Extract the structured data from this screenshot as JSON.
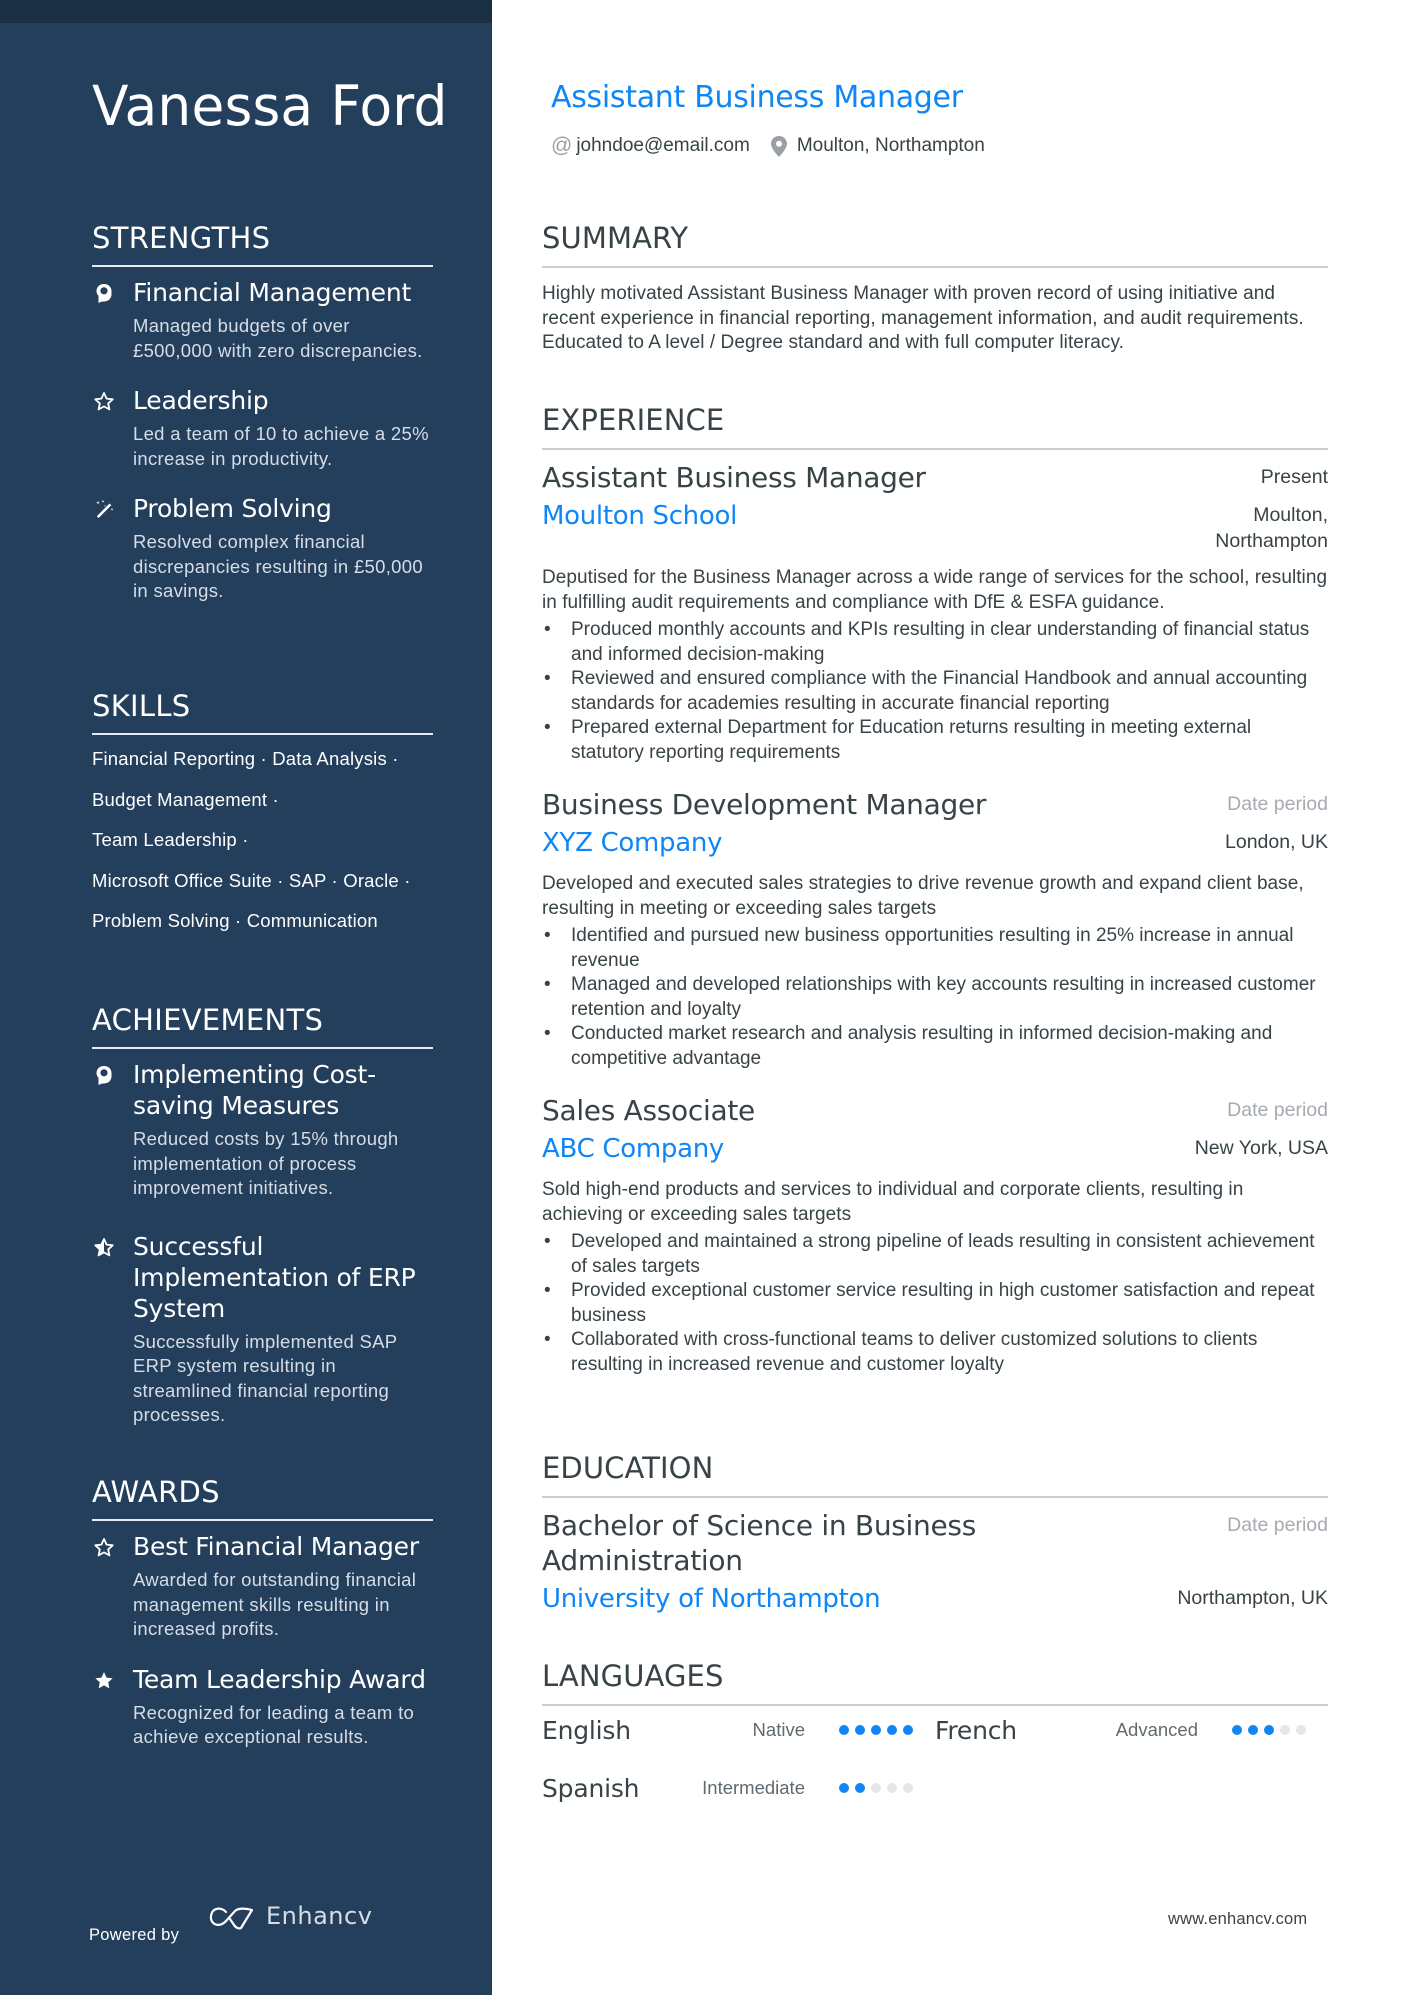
{
  "colors": {
    "sidebar_bg": "#233f5c",
    "sidebar_top": "#1b2f45",
    "accent": "#0f86f5",
    "text": "#384347",
    "muted": "#a5abb0",
    "dot_off": "#e4e6e9"
  },
  "sidebar": {
    "name": "Vanessa Ford",
    "strengths": {
      "heading": "STRENGTHS",
      "items": [
        {
          "icon": "head-brain-icon",
          "title": "Financial Management",
          "desc": "Managed budgets of over £500,000 with zero discrepancies."
        },
        {
          "icon": "star-outline-icon",
          "title": "Leadership",
          "desc": "Led a team of 10 to achieve a 25% increase in productivity."
        },
        {
          "icon": "magic-wand-icon",
          "title": "Problem Solving",
          "desc": "Resolved complex financial discrepancies resulting in £50,000 in savings."
        }
      ]
    },
    "skills": {
      "heading": "SKILLS",
      "lines": [
        "Financial Reporting · Data Analysis ·",
        "Budget Management ·",
        "Team Leadership ·",
        "Microsoft Office Suite · SAP · Oracle ·",
        "Problem Solving · Communication"
      ],
      "items": [
        "Financial Reporting",
        "Data Analysis",
        "Budget Management",
        "Team Leadership",
        "Microsoft Office Suite",
        "SAP",
        "Oracle",
        "Problem Solving",
        "Communication"
      ]
    },
    "achievements": {
      "heading": "ACHIEVEMENTS",
      "items": [
        {
          "icon": "head-brain-icon",
          "title": "Implementing Cost-saving Measures",
          "desc": "Reduced costs by 15% through implementation of process improvement initiatives."
        },
        {
          "icon": "star-half-icon",
          "title": "Successful Implementation of ERP System",
          "desc": "Successfully implemented SAP ERP system resulting in streamlined financial reporting processes."
        }
      ]
    },
    "awards": {
      "heading": "AWARDS",
      "items": [
        {
          "icon": "star-outline-icon",
          "title": "Best Financial Manager",
          "desc": "Awarded for outstanding financial management skills resulting in increased profits."
        },
        {
          "icon": "star-filled-icon",
          "title": "Team Leadership Award",
          "desc": "Recognized for leading a team to achieve exceptional results."
        }
      ]
    },
    "footer": {
      "powered_by": "Powered by",
      "brand": "Enhancv"
    }
  },
  "header": {
    "title": "Assistant Business Manager",
    "email": "johndoe@email.com",
    "location": "Moulton, Northampton"
  },
  "summary": {
    "heading": "SUMMARY",
    "text": "Highly motivated Assistant Business Manager with proven record of using initiative and recent experience in financial reporting, management information, and audit requirements. Educated to A level / Degree standard and with full computer literacy."
  },
  "experience": {
    "heading": "EXPERIENCE",
    "jobs": [
      {
        "role": "Assistant Business Manager",
        "date": "Present",
        "company": "Moulton School",
        "location": "Moulton, Northampton",
        "description": "Deputised for the Business Manager across a wide range of services for the school, resulting in fulfilling audit requirements and compliance with DfE & ESFA guidance.",
        "bullets": [
          "Produced monthly accounts and KPIs resulting in clear understanding of financial status and informed decision-making",
          "Reviewed and ensured compliance with the Financial Handbook and annual accounting standards for academies resulting in accurate financial reporting",
          "Prepared external Department for Education returns resulting in meeting external statutory reporting requirements"
        ]
      },
      {
        "role": "Business Development Manager",
        "date": "Date period",
        "company": "XYZ Company",
        "location": "London, UK",
        "description": "Developed and executed sales strategies to drive revenue growth and expand client base, resulting in meeting or exceeding sales targets",
        "bullets": [
          "Identified and pursued new business opportunities resulting in 25% increase in annual revenue",
          "Managed and developed relationships with key accounts resulting in increased customer retention and loyalty",
          "Conducted market research and analysis resulting in informed decision-making and competitive advantage"
        ]
      },
      {
        "role": "Sales Associate",
        "date": "Date period",
        "company": "ABC Company",
        "location": "New York, USA",
        "description": "Sold high-end products and services to individual and corporate clients, resulting in achieving or exceeding sales targets",
        "bullets": [
          "Developed and maintained a strong pipeline of leads resulting in consistent achievement of sales targets",
          "Provided exceptional customer service resulting in high customer satisfaction and repeat business",
          "Collaborated with cross-functional teams to deliver customized solutions to clients resulting in increased revenue and customer loyalty"
        ]
      }
    ]
  },
  "education": {
    "heading": "EDUCATION",
    "items": [
      {
        "degree": "Bachelor of Science in Business Administration",
        "date": "Date period",
        "school": "University of Northampton",
        "location": "Northampton, UK"
      }
    ]
  },
  "languages": {
    "heading": "LANGUAGES",
    "max_level": 5,
    "items": [
      {
        "name": "English",
        "level": "Native",
        "rating": 5
      },
      {
        "name": "French",
        "level": "Advanced",
        "rating": 3
      },
      {
        "name": "Spanish",
        "level": "Intermediate",
        "rating": 2
      }
    ]
  },
  "footer": {
    "url": "www.enhancv.com"
  }
}
